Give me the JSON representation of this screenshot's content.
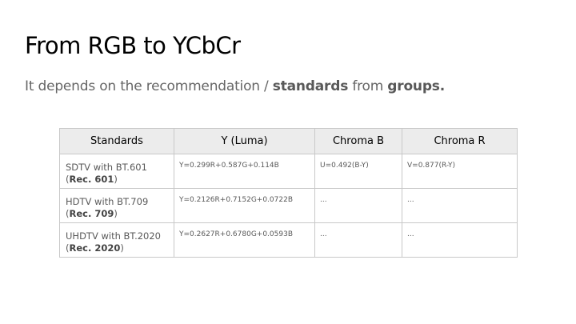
{
  "slide": {
    "title": "From RGB to YCbCr",
    "subtitle": {
      "prefix": "It depends on the recommendation / ",
      "bold1": "standards",
      "middle": " from ",
      "bold2": "groups."
    }
  },
  "table": {
    "headers": [
      "Standards",
      "Y (Luma)",
      "Chroma B",
      "Chroma R"
    ],
    "rows": [
      {
        "standard": "SDTV with BT.601",
        "rec_open": "(",
        "rec": "Rec. 601",
        "rec_close": ")",
        "y": "Y=0.299R+0.587G+0.114B",
        "cb": "U=0.492(B-Y)",
        "cr": "V=0.877(R-Y)"
      },
      {
        "standard": "HDTV with BT.709",
        "rec_open": "(",
        "rec": "Rec. 709",
        "rec_close": ")",
        "y": "Y=0.2126R+0.7152G+0.0722B",
        "cb": "...",
        "cr": "..."
      },
      {
        "standard": "UHDTV with BT.2020",
        "rec_open": "(",
        "rec": "Rec. 2020",
        "rec_close": ")",
        "y": "Y=0.2627R+0.6780G+0.0593B",
        "cb": "...",
        "cr": "..."
      }
    ]
  }
}
